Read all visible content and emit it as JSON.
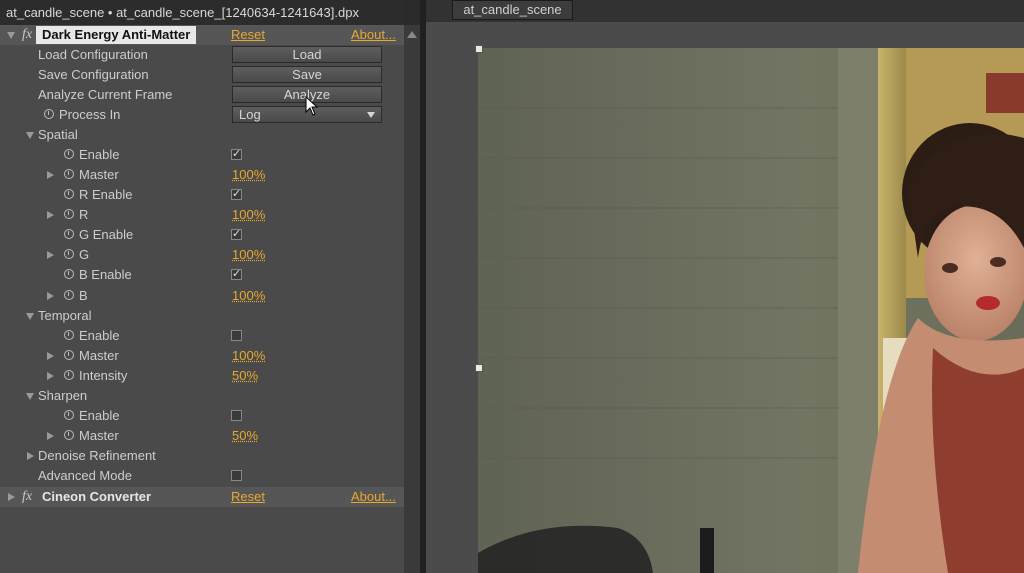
{
  "left_panel": {
    "title": "at_candle_scene • at_candle_scene_[1240634-1241643].dpx",
    "effect1": {
      "name": "Dark Energy Anti-Matter",
      "reset": "Reset",
      "about": "About...",
      "load_config": {
        "label": "Load Configuration",
        "button": "Load"
      },
      "save_config": {
        "label": "Save Configuration",
        "button": "Save"
      },
      "analyze": {
        "label": "Analyze Current Frame",
        "button": "Analyze"
      },
      "process_in": {
        "label": "Process In",
        "value": "Log"
      },
      "spatial": {
        "label": "Spatial",
        "enable": "Enable",
        "master": {
          "label": "Master",
          "value": "100%"
        },
        "r_enable": "R Enable",
        "r": {
          "label": "R",
          "value": "100%"
        },
        "g_enable": "G Enable",
        "g": {
          "label": "G",
          "value": "100%"
        },
        "b_enable": "B Enable",
        "b": {
          "label": "B",
          "value": "100%"
        }
      },
      "temporal": {
        "label": "Temporal",
        "enable": "Enable",
        "master": {
          "label": "Master",
          "value": "100%"
        },
        "intensity": {
          "label": "Intensity",
          "value": "50%"
        }
      },
      "sharpen": {
        "label": "Sharpen",
        "enable": "Enable",
        "master": {
          "label": "Master",
          "value": "50%"
        }
      },
      "denoise": "Denoise Refinement",
      "advanced": "Advanced Mode"
    },
    "effect2": {
      "name": "Cineon Converter",
      "reset": "Reset",
      "about": "About..."
    }
  },
  "viewer": {
    "tab": "at_candle_scene"
  },
  "checks": {
    "on": "✓",
    "off": ""
  },
  "icons": {
    "effect": "fx"
  }
}
